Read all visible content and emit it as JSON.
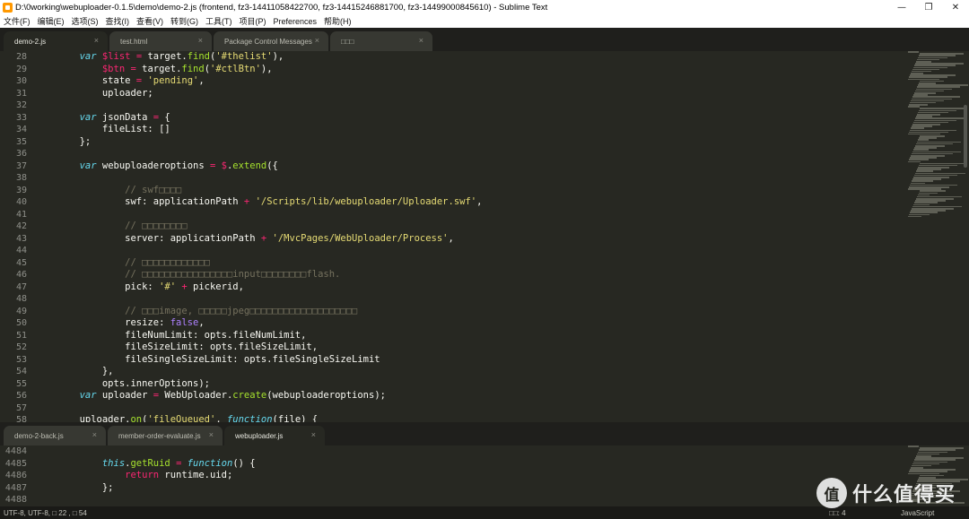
{
  "window": {
    "title": "D:\\0working\\webuploader-0.1.5\\demo\\demo-2.js (frontend, fz3-14411058422700, fz3-14415246881700, fz3-14499000845610) - Sublime Text",
    "controls": [
      "—",
      "❐",
      "✕"
    ]
  },
  "menu": [
    "文件(F)",
    "编辑(E)",
    "选项(S)",
    "查找(I)",
    "查看(V)",
    "转到(G)",
    "工具(T)",
    "项目(P)",
    "Preferences",
    "帮助(H)"
  ],
  "top_tabs": [
    "demo-2.js",
    "test.html",
    "Package Control Messages",
    "□□□"
  ],
  "bottom_tabs": [
    "demo-2-back.js",
    "member-order-evaluate.js",
    "webuploader.js"
  ],
  "close_glyph": "×",
  "top_pane": {
    "lines": [
      {
        "n": "28",
        "t": [
          [
            "        ",
            ""
          ],
          [
            "var",
            "k"
          ],
          [
            " ",
            ""
          ],
          [
            "$list",
            "v"
          ],
          [
            " ",
            ""
          ],
          [
            "=",
            "v"
          ],
          [
            " target.",
            ""
          ],
          [
            "find",
            "f"
          ],
          [
            "(",
            ""
          ],
          [
            "'#thelist'",
            "s"
          ],
          [
            "),",
            ""
          ]
        ]
      },
      {
        "n": "29",
        "t": [
          [
            "            ",
            ""
          ],
          [
            "$btn",
            "v"
          ],
          [
            " ",
            ""
          ],
          [
            "=",
            "v"
          ],
          [
            " target.",
            ""
          ],
          [
            "find",
            "f"
          ],
          [
            "(",
            ""
          ],
          [
            "'#ctlBtn'",
            "s"
          ],
          [
            "),",
            ""
          ]
        ]
      },
      {
        "n": "30",
        "t": [
          [
            "            state ",
            ""
          ],
          [
            "=",
            "v"
          ],
          [
            " ",
            ""
          ],
          [
            "'pending'",
            "s"
          ],
          [
            ",",
            ""
          ]
        ]
      },
      {
        "n": "31",
        "t": [
          [
            "            uploader;",
            ""
          ]
        ]
      },
      {
        "n": "32",
        "t": [
          [
            "",
            ""
          ]
        ]
      },
      {
        "n": "33",
        "t": [
          [
            "        ",
            ""
          ],
          [
            "var",
            "k"
          ],
          [
            " jsonData ",
            ""
          ],
          [
            "=",
            "v"
          ],
          [
            " {",
            ""
          ]
        ]
      },
      {
        "n": "34",
        "t": [
          [
            "            fileList: []",
            ""
          ]
        ]
      },
      {
        "n": "35",
        "t": [
          [
            "        };",
            ""
          ]
        ]
      },
      {
        "n": "36",
        "t": [
          [
            "",
            ""
          ]
        ]
      },
      {
        "n": "37",
        "t": [
          [
            "        ",
            ""
          ],
          [
            "var",
            "k"
          ],
          [
            " webuploaderoptions ",
            ""
          ],
          [
            "=",
            "v"
          ],
          [
            " ",
            ""
          ],
          [
            "$",
            "v"
          ],
          [
            ".",
            ""
          ],
          [
            "extend",
            "f"
          ],
          [
            "({",
            ""
          ]
        ]
      },
      {
        "n": "38",
        "t": [
          [
            "",
            ""
          ]
        ]
      },
      {
        "n": "39",
        "t": [
          [
            "                ",
            ""
          ],
          [
            "// swf□□□□",
            "c"
          ]
        ]
      },
      {
        "n": "40",
        "t": [
          [
            "                swf: applicationPath ",
            ""
          ],
          [
            "+",
            "v"
          ],
          [
            " ",
            ""
          ],
          [
            "'/Scripts/lib/webuploader/Uploader.swf'",
            "s"
          ],
          [
            ",",
            ""
          ]
        ]
      },
      {
        "n": "41",
        "t": [
          [
            "",
            ""
          ]
        ]
      },
      {
        "n": "42",
        "t": [
          [
            "                ",
            ""
          ],
          [
            "// □□□□□□□□",
            "c"
          ]
        ]
      },
      {
        "n": "43",
        "t": [
          [
            "                server: applicationPath ",
            ""
          ],
          [
            "+",
            "v"
          ],
          [
            " ",
            ""
          ],
          [
            "'/MvcPages/WebUploader/Process'",
            "s"
          ],
          [
            ",",
            ""
          ]
        ]
      },
      {
        "n": "44",
        "t": [
          [
            "",
            ""
          ]
        ]
      },
      {
        "n": "45",
        "t": [
          [
            "                ",
            ""
          ],
          [
            "// □□□□□□□□□□□□",
            "c"
          ]
        ]
      },
      {
        "n": "46",
        "t": [
          [
            "                ",
            ""
          ],
          [
            "// □□□□□□□□□□□□□□□□input□□□□□□□□flash.",
            "c"
          ]
        ]
      },
      {
        "n": "47",
        "t": [
          [
            "                pick: ",
            ""
          ],
          [
            "'#'",
            "s"
          ],
          [
            " ",
            ""
          ],
          [
            "+",
            "v"
          ],
          [
            " pickerid,",
            ""
          ]
        ]
      },
      {
        "n": "48",
        "t": [
          [
            "",
            ""
          ]
        ]
      },
      {
        "n": "49",
        "t": [
          [
            "                ",
            ""
          ],
          [
            "// □□□image, □□□□□jpeg□□□□□□□□□□□□□□□□□□□",
            "c"
          ]
        ]
      },
      {
        "n": "50",
        "t": [
          [
            "                resize: ",
            ""
          ],
          [
            "false",
            "n"
          ],
          [
            ",",
            ""
          ]
        ]
      },
      {
        "n": "51",
        "t": [
          [
            "                fileNumLimit: opts.fileNumLimit,",
            ""
          ]
        ]
      },
      {
        "n": "52",
        "t": [
          [
            "                fileSizeLimit: opts.fileSizeLimit,",
            ""
          ]
        ]
      },
      {
        "n": "53",
        "t": [
          [
            "                fileSingleSizeLimit: opts.fileSingleSizeLimit",
            ""
          ]
        ]
      },
      {
        "n": "54",
        "t": [
          [
            "            },",
            ""
          ]
        ]
      },
      {
        "n": "55",
        "t": [
          [
            "            opts.innerOptions);",
            ""
          ]
        ]
      },
      {
        "n": "56",
        "t": [
          [
            "        ",
            ""
          ],
          [
            "var",
            "k"
          ],
          [
            " uploader ",
            ""
          ],
          [
            "=",
            "v"
          ],
          [
            " WebUploader.",
            ""
          ],
          [
            "create",
            "f"
          ],
          [
            "(webuploaderoptions);",
            ""
          ]
        ]
      },
      {
        "n": "57",
        "t": [
          [
            "",
            ""
          ]
        ]
      },
      {
        "n": "58",
        "t": [
          [
            "        uploader.",
            ""
          ],
          [
            "on",
            "f"
          ],
          [
            "(",
            ""
          ],
          [
            "'fileQueued'",
            "s"
          ],
          [
            ", ",
            ""
          ],
          [
            "function",
            "k"
          ],
          [
            "(file) {",
            ""
          ]
        ]
      }
    ]
  },
  "bottom_pane": {
    "lines": [
      {
        "n": "4484",
        "t": [
          [
            "",
            ""
          ]
        ]
      },
      {
        "n": "4485",
        "t": [
          [
            "            ",
            ""
          ],
          [
            "this",
            "k"
          ],
          [
            ".",
            ""
          ],
          [
            "getRuid",
            "f"
          ],
          [
            " ",
            ""
          ],
          [
            "=",
            "v"
          ],
          [
            " ",
            ""
          ],
          [
            "function",
            "k"
          ],
          [
            "() {",
            ""
          ]
        ]
      },
      {
        "n": "4486",
        "t": [
          [
            "                ",
            ""
          ],
          [
            "return",
            "v"
          ],
          [
            " runtime.uid;",
            ""
          ]
        ]
      },
      {
        "n": "4487",
        "t": [
          [
            "            };",
            ""
          ]
        ]
      },
      {
        "n": "4488",
        "t": [
          [
            "",
            ""
          ]
        ]
      }
    ]
  },
  "status": {
    "left": "UTF-8, UTF-8, □ 22 , □ 54",
    "spaces": "□□: 4",
    "syntax": "JavaScript"
  },
  "watermark": {
    "logo": "值",
    "text": "什么值得买"
  }
}
